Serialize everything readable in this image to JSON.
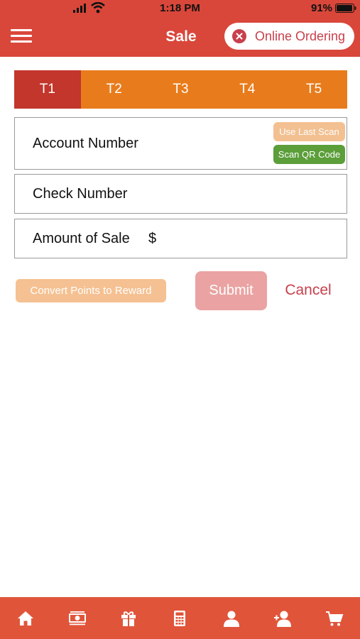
{
  "status_bar": {
    "time": "1:18 PM",
    "battery_percent": "91%"
  },
  "header": {
    "title": "Sale",
    "menu_icon": "hamburger-icon",
    "online_ordering_label": "Online Ordering",
    "online_ordering_icon": "close-circle-icon"
  },
  "tabs": [
    {
      "label": "T1",
      "active": true
    },
    {
      "label": "T2",
      "active": false
    },
    {
      "label": "T3",
      "active": false
    },
    {
      "label": "T4",
      "active": false
    },
    {
      "label": "T5",
      "active": false
    }
  ],
  "form": {
    "account_number_label": "Account Number",
    "use_last_scan_label": "Use Last Scan",
    "scan_qr_label": "Scan QR Code",
    "check_number_label": "Check Number",
    "amount_label": "Amount of Sale",
    "currency_symbol": "$"
  },
  "actions": {
    "convert_label": "Convert Points to Reward",
    "submit_label": "Submit",
    "cancel_label": "Cancel"
  },
  "bottom_nav": [
    {
      "icon": "home-icon"
    },
    {
      "icon": "money-icon"
    },
    {
      "icon": "gift-icon"
    },
    {
      "icon": "calculator-icon"
    },
    {
      "icon": "user-icon"
    },
    {
      "icon": "add-user-icon"
    },
    {
      "icon": "cart-icon"
    }
  ],
  "colors": {
    "header_red": "#d9473a",
    "tab_orange": "#e87c1c",
    "tab_active": "#c2362c",
    "accent_text": "#c8404c",
    "qr_green": "#5b9e3a",
    "nav_bar": "#e0553a"
  }
}
